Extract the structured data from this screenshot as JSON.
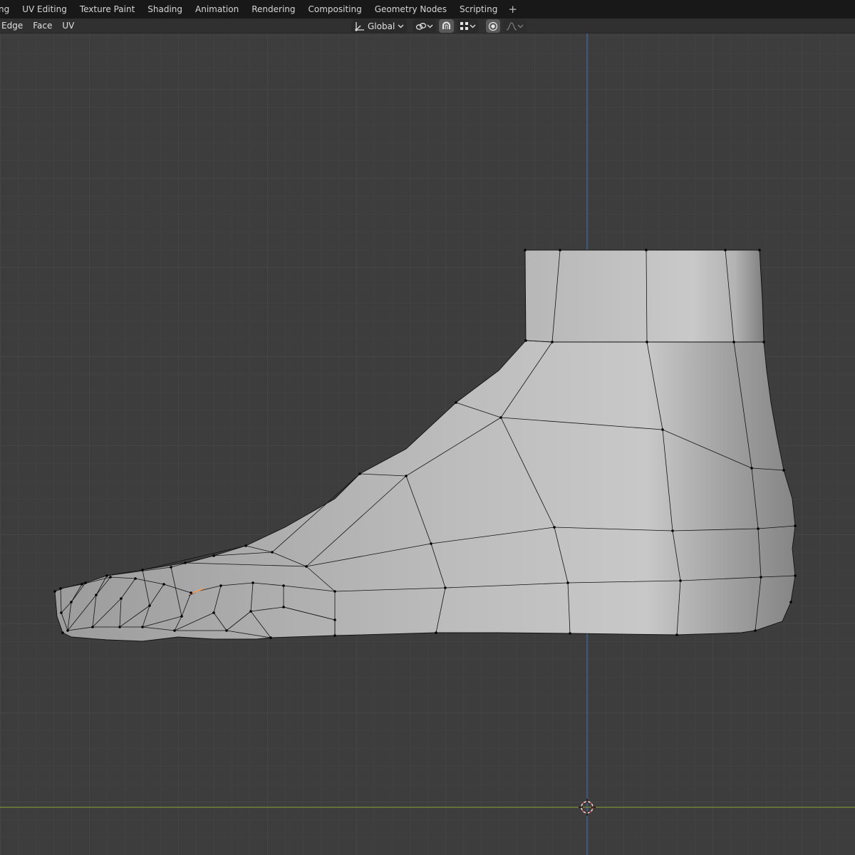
{
  "workspace_tabs": [
    "ng",
    "UV Editing",
    "Texture Paint",
    "Shading",
    "Animation",
    "Rendering",
    "Compositing",
    "Geometry Nodes",
    "Scripting"
  ],
  "workspace_add_label": "+",
  "header_menus": [
    "Edge",
    "Face",
    "UV"
  ],
  "transform_orientation": "Global",
  "icons": {
    "orientation": "transform-orientation-icon",
    "pivot": "pivot-link-icon",
    "snap": "snap-magnet-icon",
    "snap_target": "snap-grid-icon",
    "proportional": "proportional-edit-icon",
    "falloff": "falloff-curve-icon",
    "cursor": "3d-cursor-icon"
  },
  "colors": {
    "viewport_bg": "#3d3d3d",
    "grid_minor": "#454545",
    "grid_major": "#4d4d4d",
    "axis_z": "#3b6fa8",
    "axis_y": "#8aa53a",
    "mesh_fill": "#b9b9b9",
    "mesh_edge": "#111111",
    "selected_edge": "#f0a060"
  }
}
